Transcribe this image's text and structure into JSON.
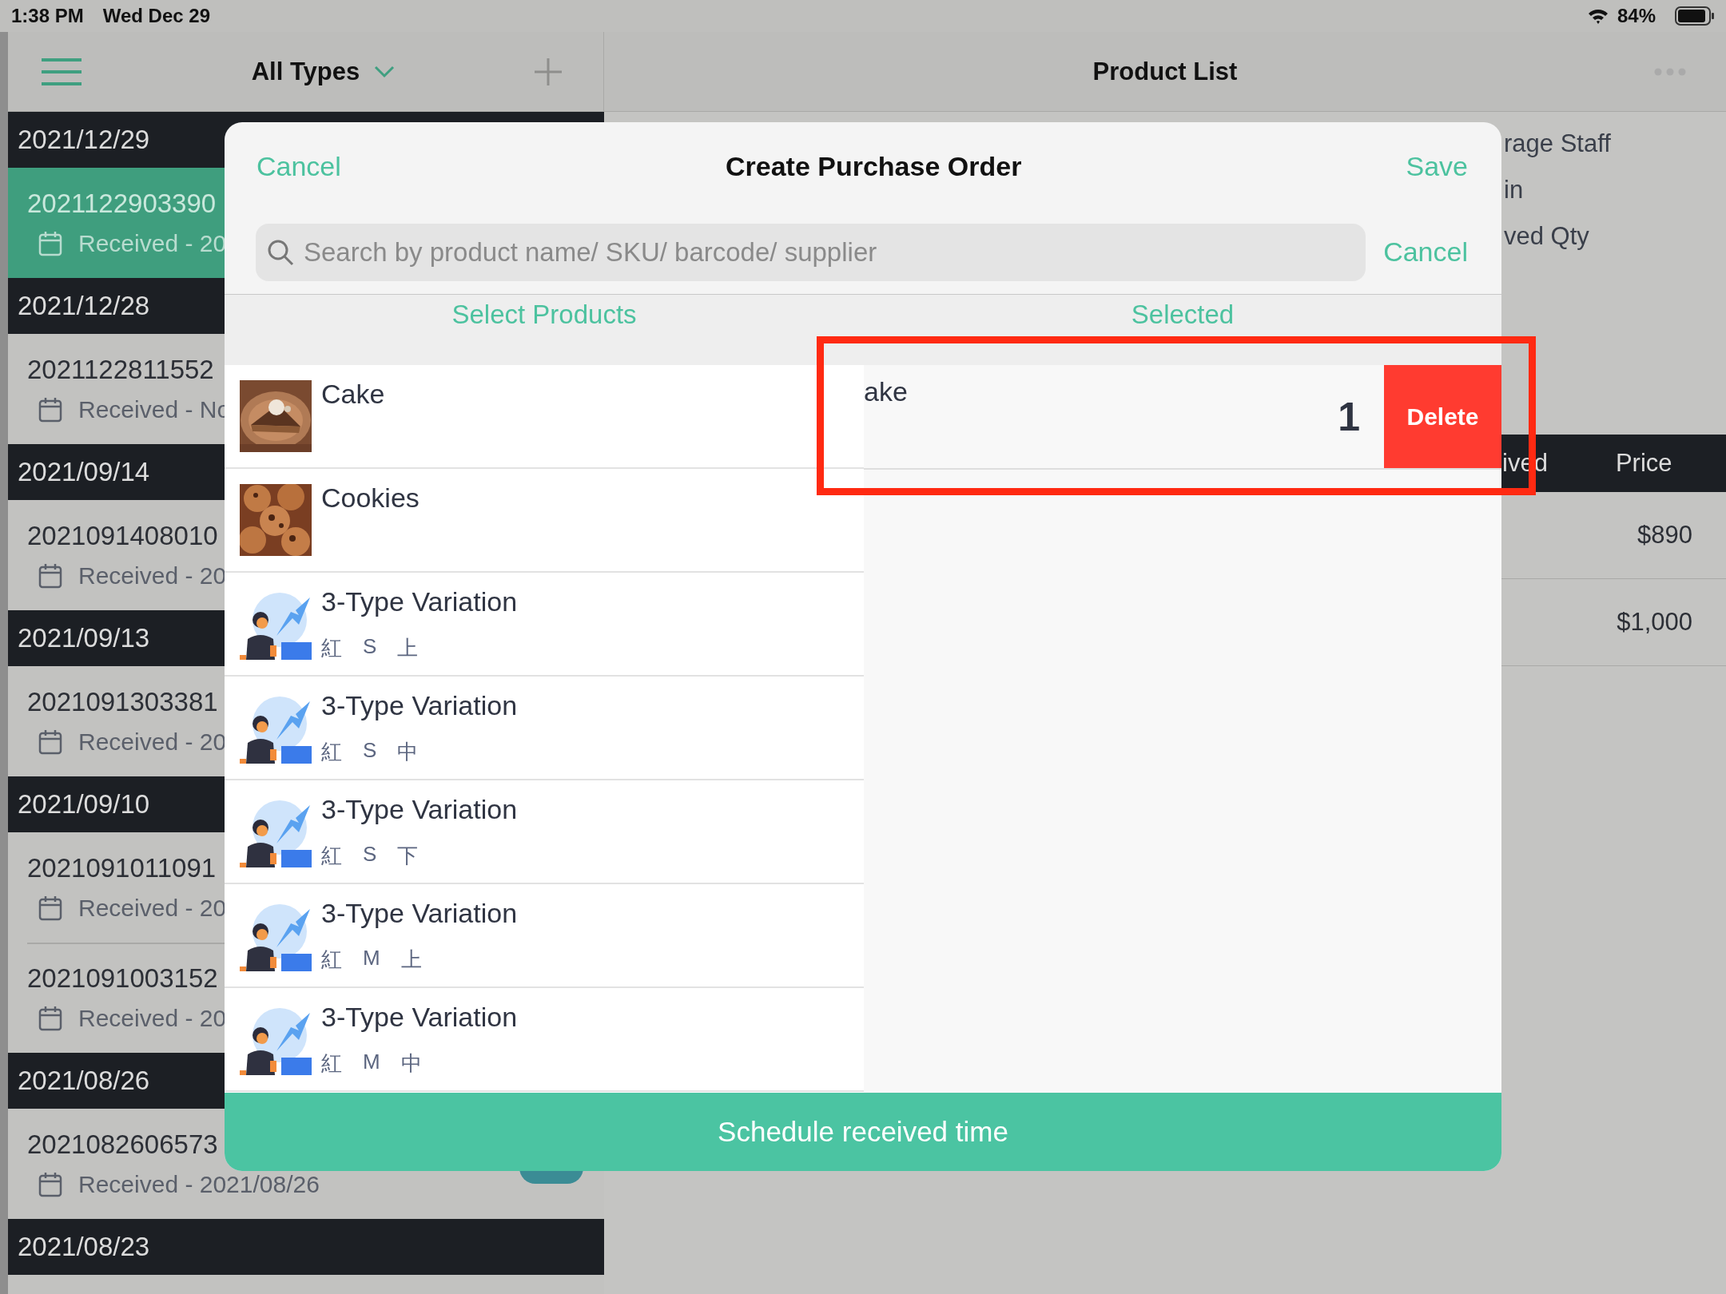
{
  "status_bar": {
    "time": "1:38 PM",
    "date": "Wed Dec 29",
    "battery": "84%"
  },
  "left_nav": {
    "filter": "All Types"
  },
  "orders": [
    {
      "date": "2021/12/29",
      "entries": [
        {
          "number": "2021122903390",
          "status": "Received - 20",
          "selected": true
        }
      ]
    },
    {
      "date": "2021/12/28",
      "entries": [
        {
          "number": "2021122811552",
          "status": "Received - No",
          "selected": false
        }
      ]
    },
    {
      "date": "2021/09/14",
      "entries": [
        {
          "number": "2021091408010",
          "status": "Received - 20",
          "selected": false
        }
      ]
    },
    {
      "date": "2021/09/13",
      "entries": [
        {
          "number": "2021091303381",
          "status": "Received - 20",
          "selected": false
        }
      ]
    },
    {
      "date": "2021/09/10",
      "entries": [
        {
          "number": "2021091011091",
          "status": "Received - 20",
          "selected": false
        },
        {
          "number": "2021091003152",
          "status": "Received - 20",
          "selected": false
        }
      ]
    },
    {
      "date": "2021/08/26",
      "entries": [
        {
          "number": "2021082606573",
          "status": "Received - 2021/08/26",
          "selected": false,
          "badge": true
        }
      ]
    },
    {
      "date": "2021/08/23"
    }
  ],
  "right_nav": {
    "title": "Product List"
  },
  "detail": {
    "info_lines": [
      "rage Staff",
      "in",
      "ved Qty"
    ],
    "columns": [
      "ived",
      "Price"
    ],
    "rows": [
      {
        "price": "$890"
      },
      {
        "price": "$1,000"
      }
    ]
  },
  "modal": {
    "cancel": "Cancel",
    "title": "Create Purchase Order",
    "save": "Save",
    "search": {
      "placeholder": "Search by product name/ SKU/ barcode/ supplier"
    },
    "search_cancel": "Cancel",
    "panes": [
      "Select Products",
      "Selected"
    ],
    "products": [
      {
        "name": "Cake",
        "kind": "cake"
      },
      {
        "name": "Cookies",
        "kind": "cookies"
      },
      {
        "name": "3-Type Variation",
        "kind": "person",
        "variants": [
          "紅",
          "S",
          "上"
        ]
      },
      {
        "name": "3-Type Variation",
        "kind": "person",
        "variants": [
          "紅",
          "S",
          "中"
        ]
      },
      {
        "name": "3-Type Variation",
        "kind": "person",
        "variants": [
          "紅",
          "S",
          "下"
        ]
      },
      {
        "name": "3-Type Variation",
        "kind": "person",
        "variants": [
          "紅",
          "M",
          "上"
        ]
      },
      {
        "name": "3-Type Variation",
        "kind": "person",
        "variants": [
          "紅",
          "M",
          "中"
        ]
      }
    ],
    "selected_items": [
      {
        "name": "ake",
        "quantity": "1",
        "action": "Delete"
      }
    ],
    "footer_button": "Schedule received time"
  }
}
